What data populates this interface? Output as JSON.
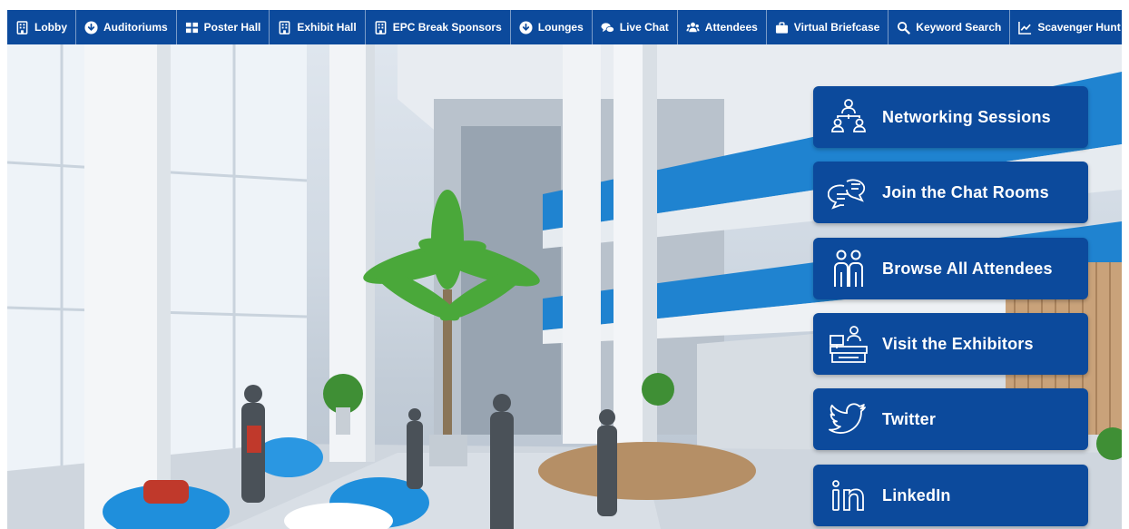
{
  "nav": {
    "items": [
      {
        "label": "Lobby",
        "icon": "building-icon"
      },
      {
        "label": "Auditoriums",
        "icon": "arrow-circle-down-icon"
      },
      {
        "label": "Poster Hall",
        "icon": "grid-icon"
      },
      {
        "label": "Exhibit Hall",
        "icon": "building-icon"
      },
      {
        "label": "EPC Break Sponsors",
        "icon": "building-icon"
      },
      {
        "label": "Lounges",
        "icon": "arrow-circle-down-icon"
      },
      {
        "label": "Live Chat",
        "icon": "chat-bubbles-icon"
      },
      {
        "label": "Attendees",
        "icon": "users-icon"
      },
      {
        "label": "Virtual Briefcase",
        "icon": "briefcase-icon"
      },
      {
        "label": "Keyword Search",
        "icon": "search-icon"
      },
      {
        "label": "Scavenger Hunt",
        "icon": "line-chart-icon"
      }
    ]
  },
  "actions": [
    {
      "label": "Networking Sessions",
      "icon": "network-people-icon"
    },
    {
      "label": "Join the Chat Rooms",
      "icon": "chat-icon"
    },
    {
      "label": "Browse All Attendees",
      "icon": "attendees-icon"
    },
    {
      "label": "Visit the Exhibitors",
      "icon": "exhibitor-booth-icon"
    },
    {
      "label": "Twitter",
      "icon": "twitter-icon"
    },
    {
      "label": "LinkedIn",
      "icon": "linkedin-icon"
    }
  ],
  "colors": {
    "nav_background": "#0c4a9c",
    "button_background": "#0c4a9c",
    "text": "#ffffff"
  }
}
